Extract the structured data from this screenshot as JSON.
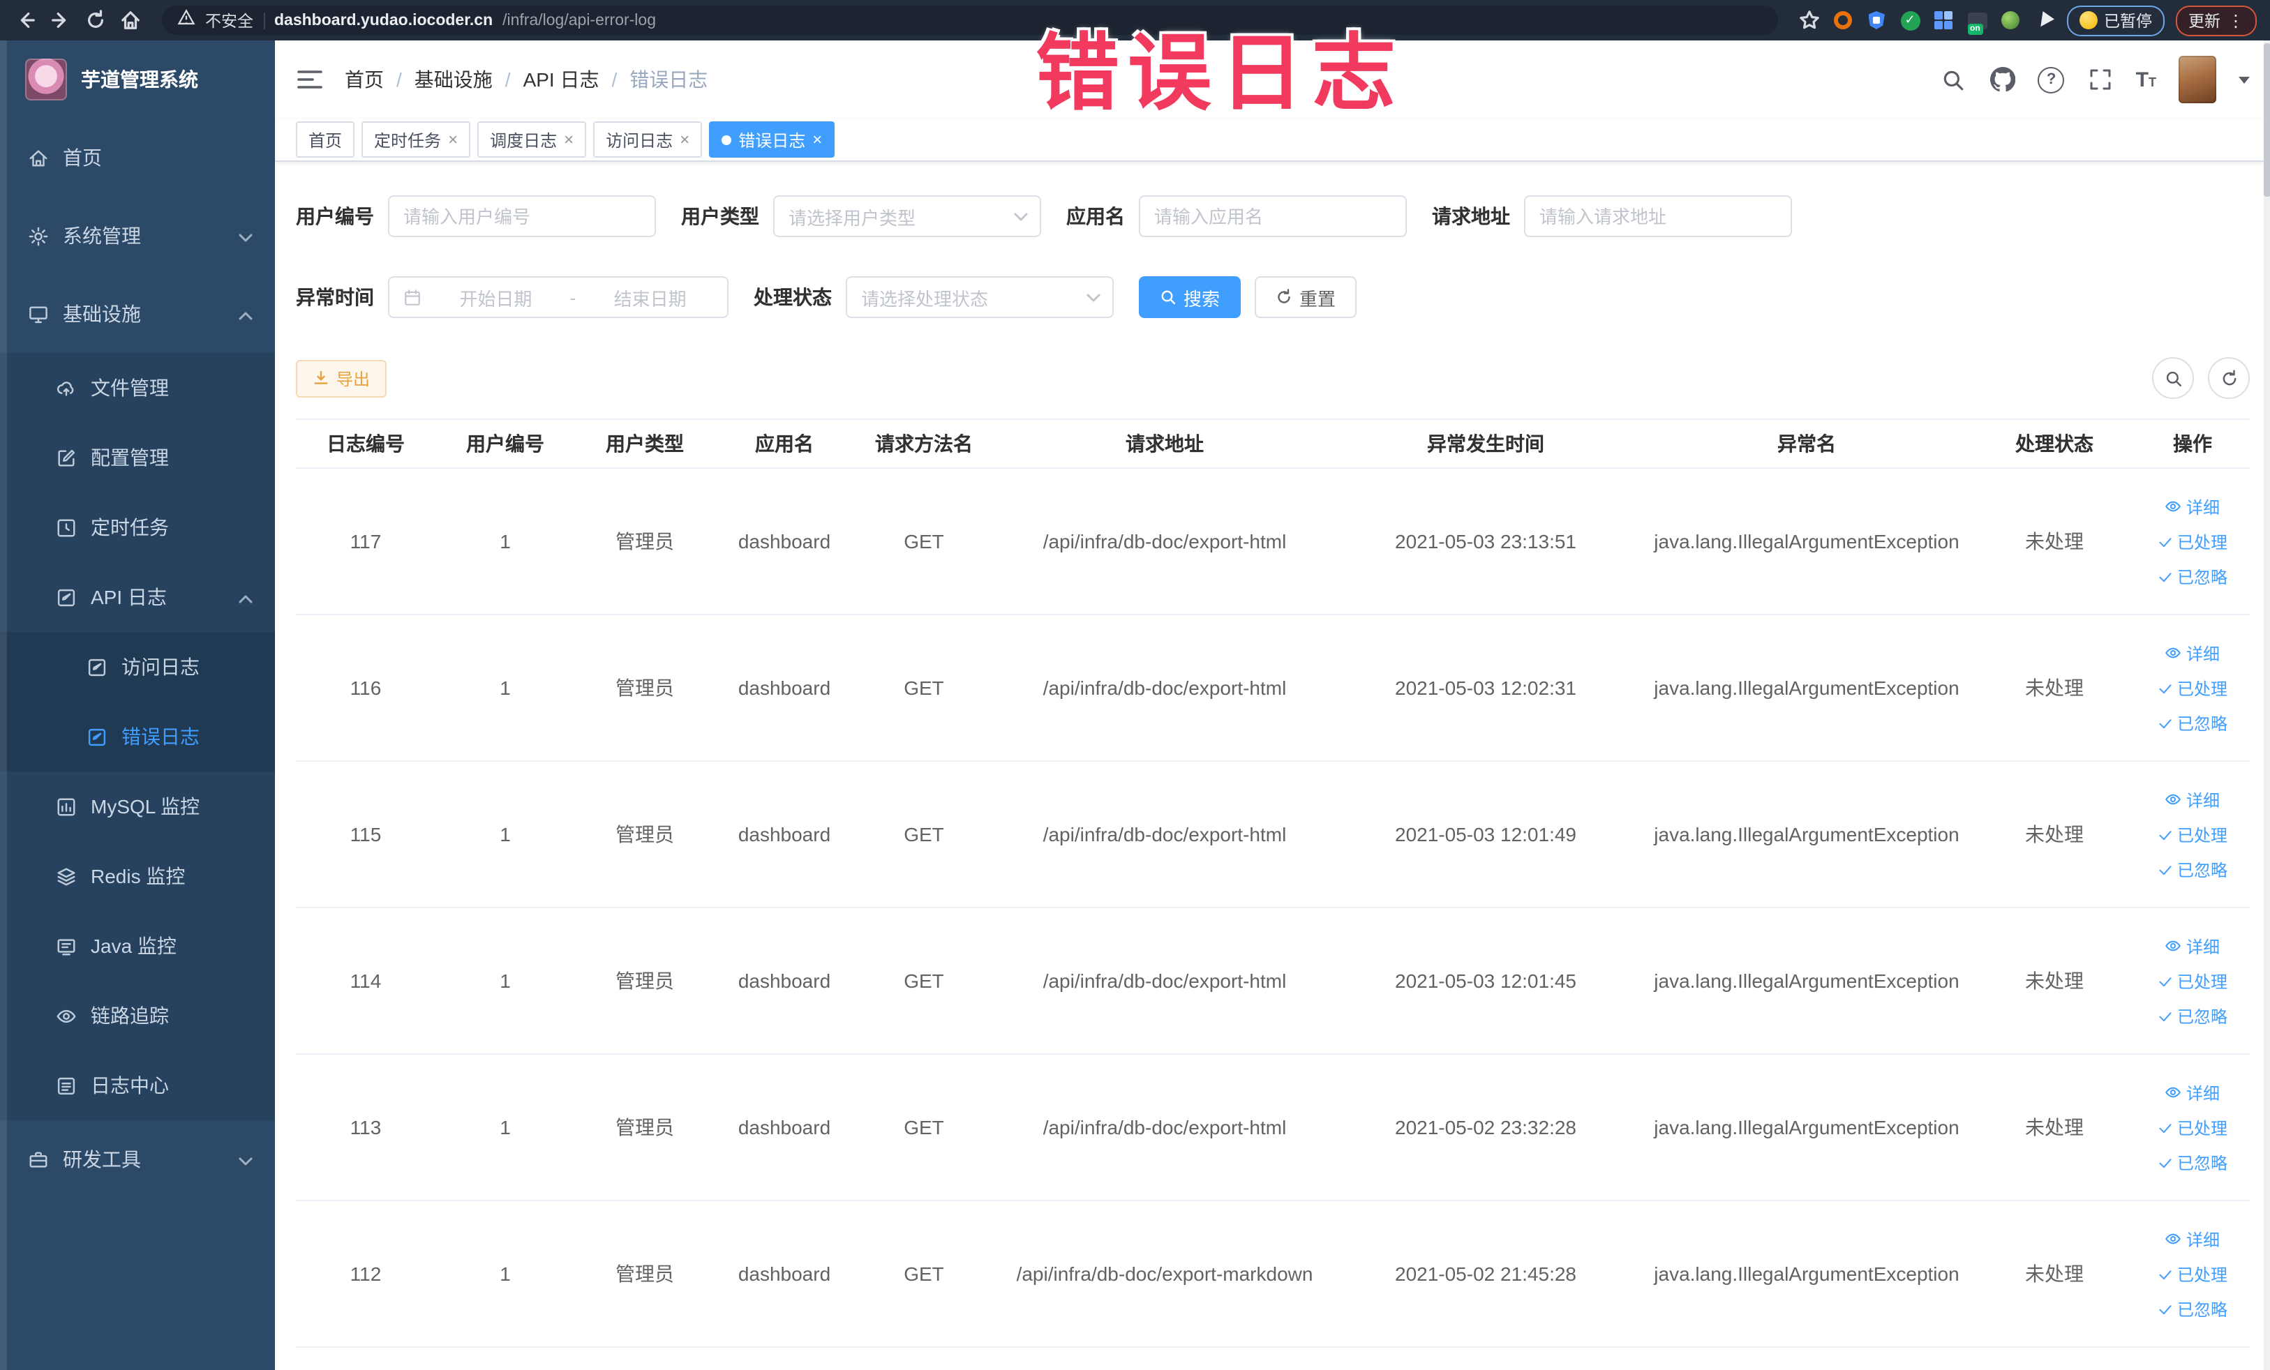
{
  "overlay": {
    "title": "错误日志"
  },
  "glyphs": {
    "close": "×",
    "separator": "/",
    "range_separator": "-",
    "kebab": "⋮",
    "question": "?",
    "t_large": "T",
    "t_small": "T",
    "on_badge": "on"
  },
  "browser": {
    "security_label": "不安全",
    "url_domain": "dashboard.yudao.iocoder.cn",
    "url_path": "/infra/log/api-error-log",
    "paused_badge": "已暂停",
    "update_badge": "更新"
  },
  "sidebar": {
    "app_title": "芋道管理系统",
    "menu": [
      {
        "label": "首页"
      },
      {
        "label": "系统管理"
      },
      {
        "label": "基础设施"
      },
      {
        "label": "文件管理"
      },
      {
        "label": "配置管理"
      },
      {
        "label": "定时任务"
      },
      {
        "label": "API 日志"
      },
      {
        "label": "访问日志"
      },
      {
        "label": "错误日志"
      },
      {
        "label": "MySQL 监控"
      },
      {
        "label": "Redis 监控"
      },
      {
        "label": "Java 监控"
      },
      {
        "label": "链路追踪"
      },
      {
        "label": "日志中心"
      },
      {
        "label": "研发工具"
      }
    ]
  },
  "header": {
    "breadcrumbs": [
      "首页",
      "基础设施",
      "API 日志",
      "错误日志"
    ]
  },
  "tabs": [
    {
      "label": "首页"
    },
    {
      "label": "定时任务"
    },
    {
      "label": "调度日志"
    },
    {
      "label": "访问日志"
    },
    {
      "label": "错误日志"
    }
  ],
  "filters": {
    "user_id_label": "用户编号",
    "user_id_placeholder": "请输入用户编号",
    "user_type_label": "用户类型",
    "user_type_placeholder": "请选择用户类型",
    "app_name_label": "应用名",
    "app_name_placeholder": "请输入应用名",
    "request_url_label": "请求地址",
    "request_url_placeholder": "请输入请求地址",
    "time_label": "异常时间",
    "time_start_placeholder": "开始日期",
    "time_end_placeholder": "结束日期",
    "status_label": "处理状态",
    "status_placeholder": "请选择处理状态",
    "search_button": "搜索",
    "reset_button": "重置"
  },
  "toolbar": {
    "export_button": "导出"
  },
  "table": {
    "columns": [
      "日志编号",
      "用户编号",
      "用户类型",
      "应用名",
      "请求方法名",
      "请求地址",
      "异常发生时间",
      "异常名",
      "处理状态",
      "操作"
    ],
    "action_labels": {
      "detail": "详细",
      "processed": "已处理",
      "ignored": "已忽略"
    },
    "rows": [
      {
        "id": "117",
        "user_id": "1",
        "user_type": "管理员",
        "app": "dashboard",
        "method": "GET",
        "url": "/api/infra/db-doc/export-html",
        "time": "2021-05-03 23:13:51",
        "exception": "java.lang.IllegalArgumentException",
        "status": "未处理"
      },
      {
        "id": "116",
        "user_id": "1",
        "user_type": "管理员",
        "app": "dashboard",
        "method": "GET",
        "url": "/api/infra/db-doc/export-html",
        "time": "2021-05-03 12:02:31",
        "exception": "java.lang.IllegalArgumentException",
        "status": "未处理"
      },
      {
        "id": "115",
        "user_id": "1",
        "user_type": "管理员",
        "app": "dashboard",
        "method": "GET",
        "url": "/api/infra/db-doc/export-html",
        "time": "2021-05-03 12:01:49",
        "exception": "java.lang.IllegalArgumentException",
        "status": "未处理"
      },
      {
        "id": "114",
        "user_id": "1",
        "user_type": "管理员",
        "app": "dashboard",
        "method": "GET",
        "url": "/api/infra/db-doc/export-html",
        "time": "2021-05-03 12:01:45",
        "exception": "java.lang.IllegalArgumentException",
        "status": "未处理"
      },
      {
        "id": "113",
        "user_id": "1",
        "user_type": "管理员",
        "app": "dashboard",
        "method": "GET",
        "url": "/api/infra/db-doc/export-html",
        "time": "2021-05-02 23:32:28",
        "exception": "java.lang.IllegalArgumentException",
        "status": "未处理"
      },
      {
        "id": "112",
        "user_id": "1",
        "user_type": "管理员",
        "app": "dashboard",
        "method": "GET",
        "url": "/api/infra/db-doc/export-markdown",
        "time": "2021-05-02 21:45:28",
        "exception": "java.lang.IllegalArgumentException",
        "status": "未处理"
      }
    ]
  },
  "colors": {
    "primary": "#409eff",
    "warning": "#e6a23c",
    "overlay": "#f13a5e",
    "sidebar_bg": "#2c4a68",
    "browser_bar_bg": "#222c3a"
  }
}
